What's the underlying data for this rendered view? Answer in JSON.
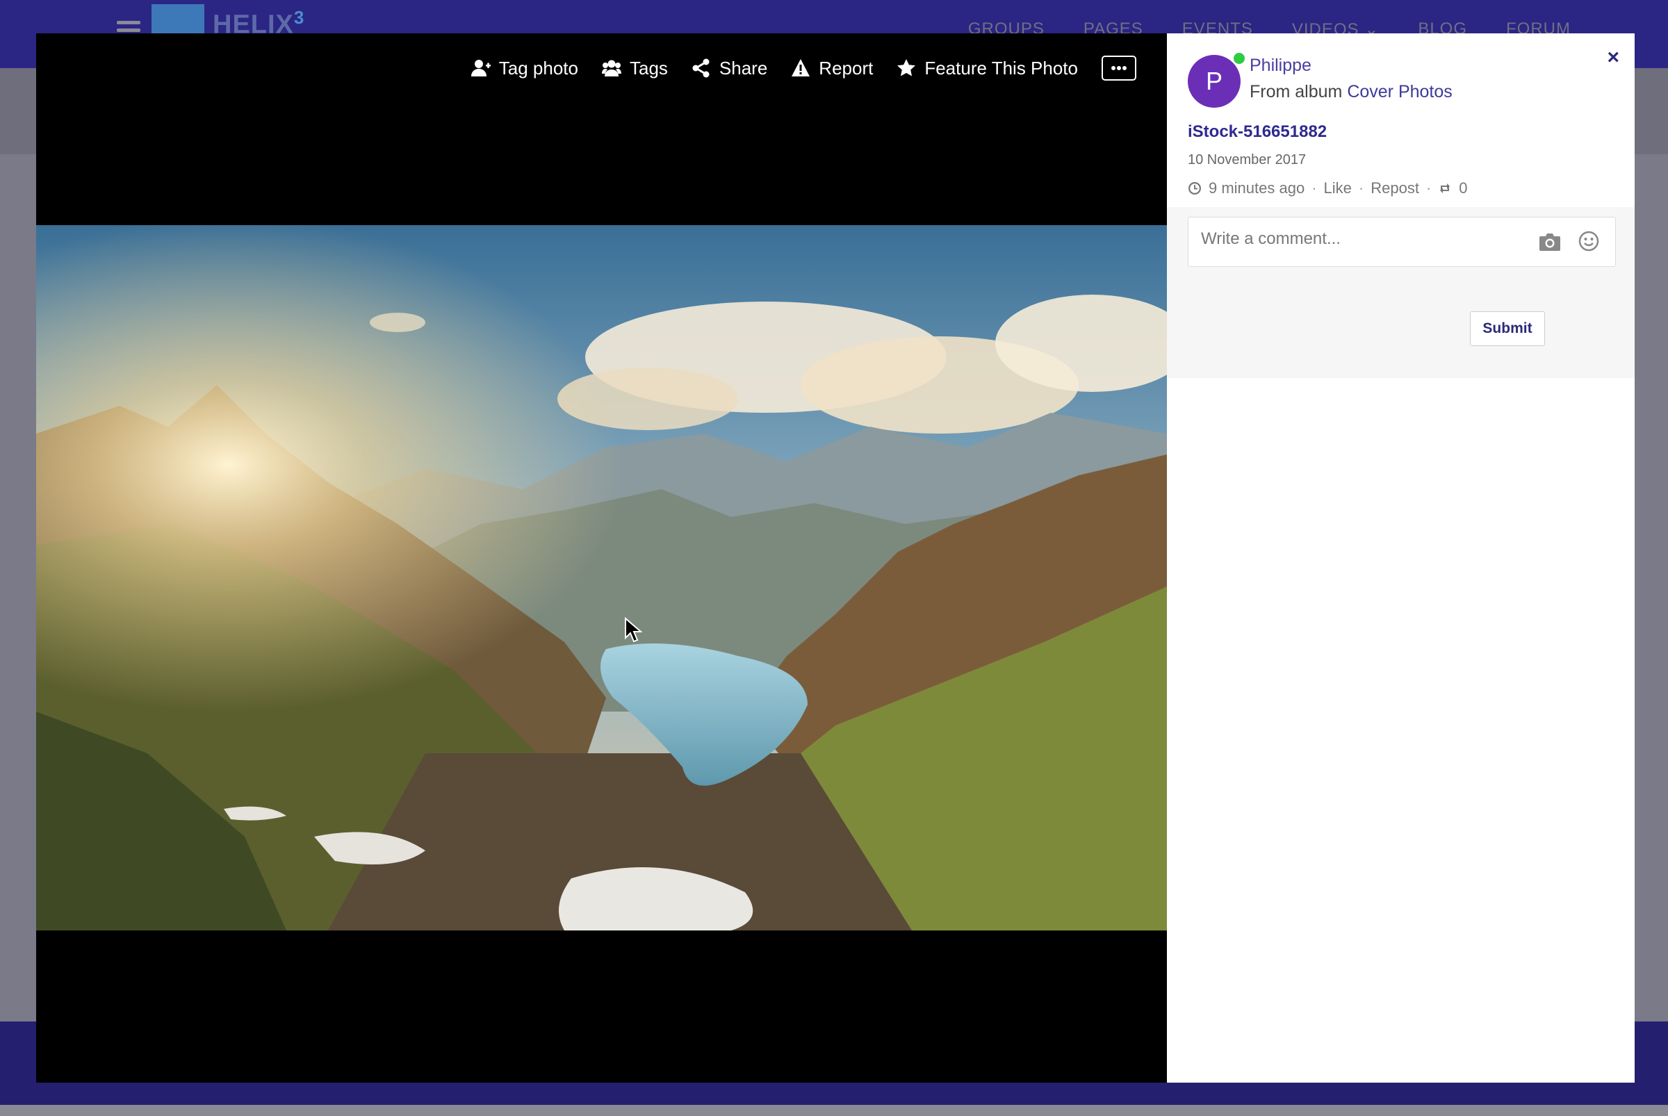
{
  "site": {
    "logo_text": "HELIX",
    "logo_sup": "3",
    "nav": [
      "GROUPS",
      "PAGES",
      "EVENTS",
      "VIDEOS",
      "BLOG",
      "FORUM"
    ]
  },
  "toolbar": {
    "tag_photo": "Tag photo",
    "tags": "Tags",
    "share": "Share",
    "report": "Report",
    "feature": "Feature This Photo"
  },
  "panel": {
    "close": "×",
    "avatar_letter": "P",
    "author": "Philippe",
    "album_prefix": "From album ",
    "album_name": "Cover Photos",
    "title": "iStock-516651882",
    "date": "10 November 2017",
    "time_ago": "9 minutes ago",
    "like": "Like",
    "repost": "Repost",
    "repost_count": "0",
    "comment_placeholder": "Write a comment...",
    "submit": "Submit"
  },
  "colors": {
    "header": "#2b2584",
    "accent": "#2f2a8e",
    "online": "#2ecc40",
    "avatar": "#6b2fb7"
  }
}
